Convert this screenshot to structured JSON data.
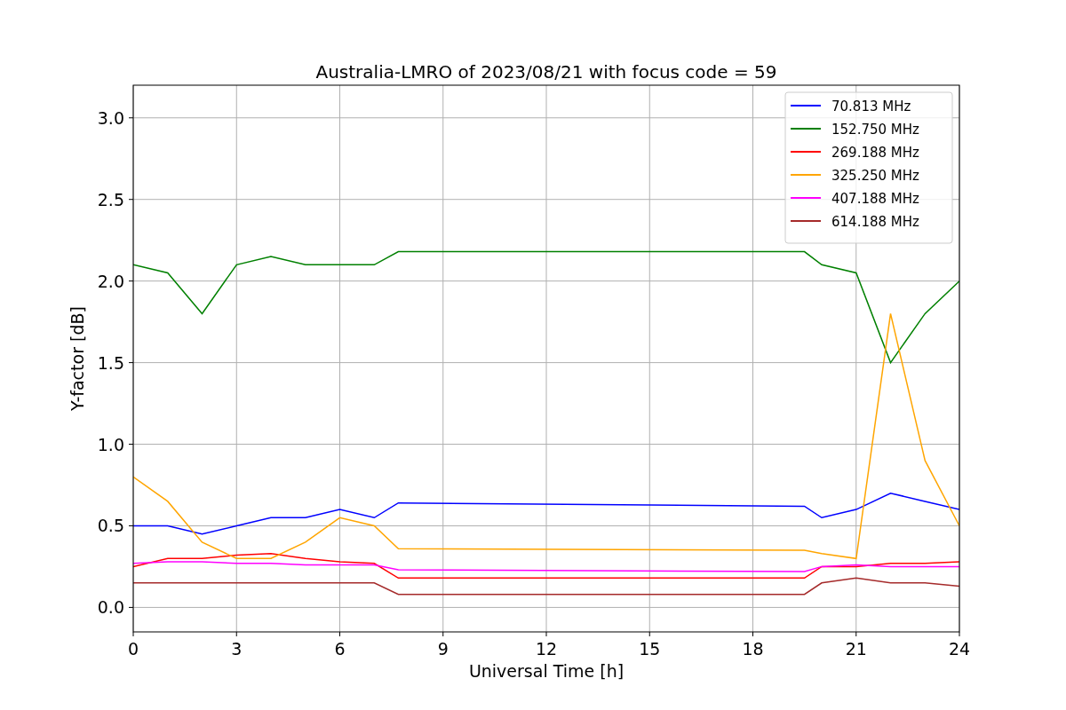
{
  "chart_data": {
    "type": "line",
    "title": "Australia-LMRO of 2023/08/21 with focus code = 59",
    "xlabel": "Universal Time [h]",
    "ylabel": "Y-factor [dB]",
    "x": [
      0,
      1,
      2,
      3,
      4,
      5,
      6,
      7,
      7.7,
      19.5,
      20,
      21,
      22,
      23,
      24
    ],
    "grid": true,
    "legend": true,
    "xlim": [
      0,
      24
    ],
    "ylim": [
      -0.15,
      3.2
    ],
    "xticks": [
      0,
      3,
      6,
      9,
      12,
      15,
      18,
      21,
      24
    ],
    "yticks": [
      {
        "value": 0,
        "label": "0.0"
      },
      {
        "value": 0.5,
        "label": "0.5"
      },
      {
        "value": 1,
        "label": "1.0"
      },
      {
        "value": 1.5,
        "label": "1.5"
      },
      {
        "value": 2,
        "label": "2.0"
      },
      {
        "value": 2.5,
        "label": "2.5"
      },
      {
        "value": 3,
        "label": "3.0"
      }
    ],
    "series": [
      {
        "name": "70.813 MHz",
        "color": "#0000ff",
        "values": [
          0.5,
          0.5,
          0.45,
          0.5,
          0.55,
          0.55,
          0.6,
          0.55,
          0.64,
          0.62,
          0.55,
          0.6,
          0.7,
          0.65,
          0.6
        ]
      },
      {
        "name": "152.750 MHz",
        "color": "#008000",
        "values": [
          2.1,
          2.05,
          1.8,
          2.1,
          2.15,
          2.1,
          2.1,
          2.1,
          2.18,
          2.18,
          2.1,
          2.05,
          1.5,
          1.8,
          2.0
        ]
      },
      {
        "name": "269.188 MHz",
        "color": "#ff0000",
        "values": [
          0.25,
          0.3,
          0.3,
          0.32,
          0.33,
          0.3,
          0.28,
          0.27,
          0.18,
          0.18,
          0.25,
          0.25,
          0.27,
          0.27,
          0.28
        ]
      },
      {
        "name": "325.250 MHz",
        "color": "#ffa500",
        "values": [
          0.8,
          0.65,
          0.4,
          0.3,
          0.3,
          0.4,
          0.55,
          0.5,
          0.36,
          0.35,
          0.33,
          0.3,
          1.8,
          0.9,
          0.5
        ]
      },
      {
        "name": "407.188 MHz",
        "color": "#ff00ff",
        "values": [
          0.27,
          0.28,
          0.28,
          0.27,
          0.27,
          0.26,
          0.26,
          0.26,
          0.23,
          0.22,
          0.25,
          0.26,
          0.25,
          0.25,
          0.25
        ]
      },
      {
        "name": "614.188 MHz",
        "color": "#a52a2a",
        "values": [
          0.15,
          0.15,
          0.15,
          0.15,
          0.15,
          0.15,
          0.15,
          0.15,
          0.08,
          0.08,
          0.15,
          0.18,
          0.15,
          0.15,
          0.13
        ]
      }
    ]
  }
}
